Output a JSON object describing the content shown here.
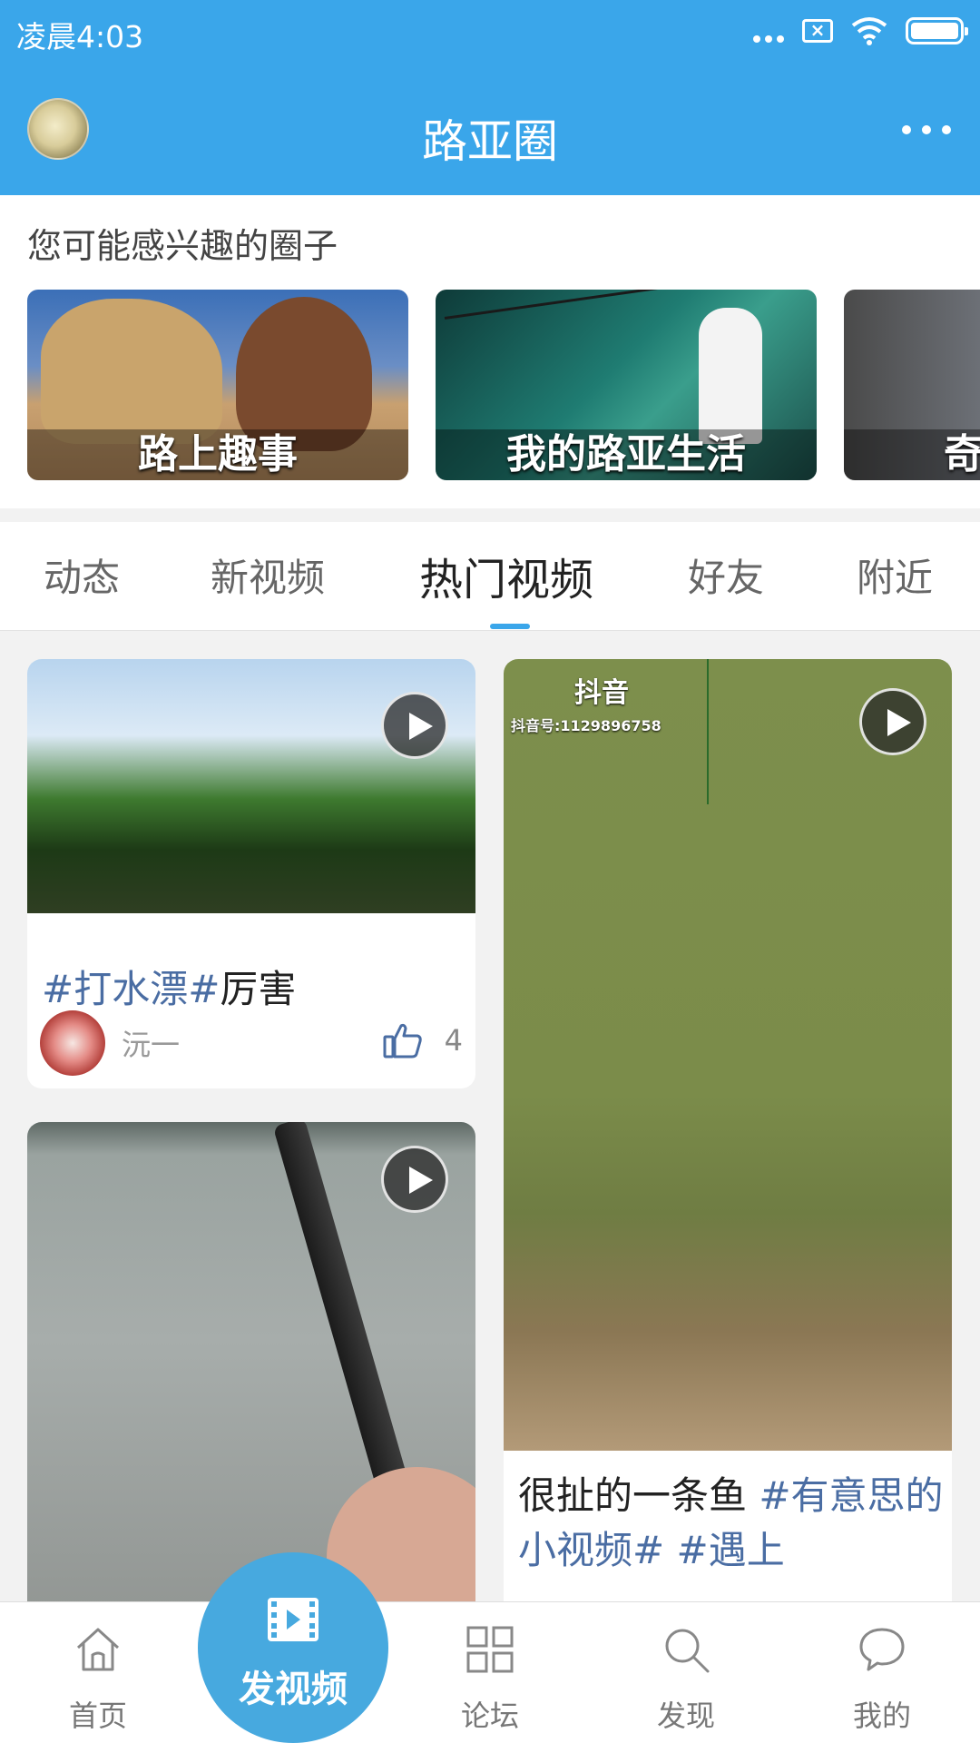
{
  "status_bar": {
    "time": "凌晨4:03"
  },
  "header": {
    "title": "路亚圈"
  },
  "circles": {
    "heading": "您可能感兴趣的圈子",
    "items": [
      {
        "label": "路上趣事"
      },
      {
        "label": "我的路亚生活"
      },
      {
        "label": "奇"
      }
    ]
  },
  "tabs": [
    "动态",
    "新视频",
    "热门视频",
    "好友",
    "附近"
  ],
  "active_tab": "热门视频",
  "feed": {
    "left": [
      {
        "tags_before": "#打水漂#",
        "text": "厉害",
        "author": "沅一",
        "likes": "4"
      }
    ],
    "right": [
      {
        "watermark_brand": "抖音",
        "watermark_id": "抖音号:1129896758",
        "text": "很扯的一条鱼 ",
        "tags": "#有意思的小视频# #遇上"
      }
    ]
  },
  "bottom_nav": {
    "home": "首页",
    "post_video": "发视频",
    "forum": "论坛",
    "discover": "发现",
    "mine": "我的"
  },
  "colors": {
    "accent": "#3aa6ea",
    "tag": "#4a6da3",
    "fab": "#47a9df"
  }
}
